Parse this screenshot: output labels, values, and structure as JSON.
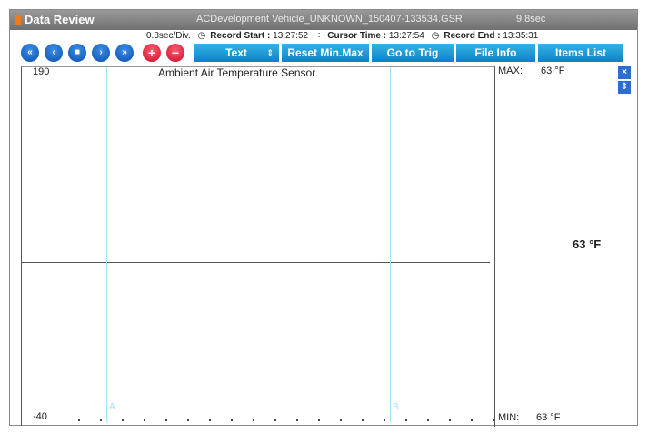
{
  "window": {
    "app_title": "Data Review",
    "file_name": "ACDevelopment Vehicle_UNKNOWN_150407-133534.GSR",
    "duration": "9.8sec"
  },
  "info": {
    "scale": "0.8sec/Div.",
    "record_start_label": "Record Start :",
    "record_start": "13:27:52",
    "cursor_time_label": "Cursor Time :",
    "cursor_time": "13:27:54",
    "record_end_label": "Record End :",
    "record_end": "13:35:31"
  },
  "toolbar": {
    "rewind_glyph": "«",
    "prev_glyph": "‹",
    "stop_glyph": "■",
    "play_glyph": "›",
    "ffwd_glyph": "»",
    "zoom_in_glyph": "+",
    "zoom_out_glyph": "−",
    "text_label": "Text",
    "reset_label": "Reset Min.Max",
    "trig_label": "Go to Trig",
    "fileinfo_label": "File Info",
    "items_label": "Items List"
  },
  "graph": {
    "title": "Ambient Air Temperature Sensor",
    "y_max": "190",
    "y_min": "-40",
    "cursor_a": "A",
    "cursor_b": "B"
  },
  "panel": {
    "max_label": "MAX:",
    "max_value": "63 °F",
    "current_value": "63 °F",
    "min_label": "MIN:",
    "min_value": "63 °F"
  },
  "icons": {
    "close": "×",
    "expand": "⇕"
  }
}
